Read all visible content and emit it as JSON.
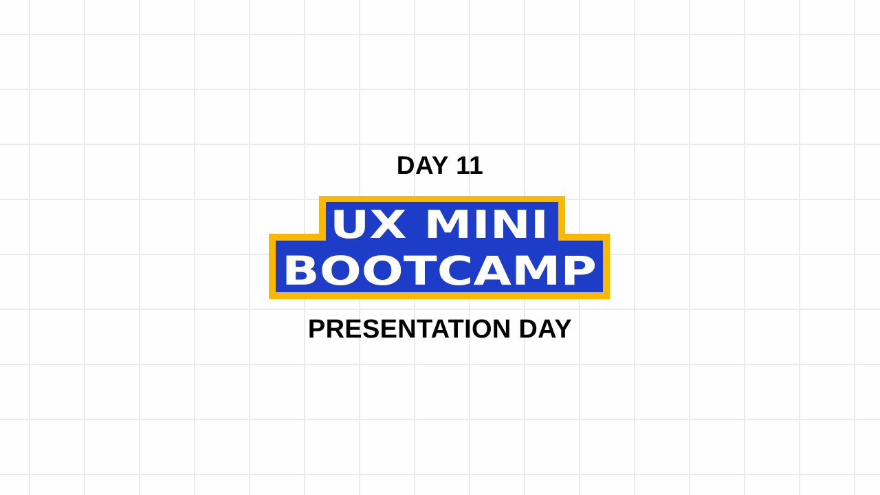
{
  "slide": {
    "day_label": "DAY 11",
    "logo": {
      "line1": "UX MINI",
      "line2": "BOOTCAMP",
      "fill_color": "#1d3dc8",
      "border_color": "#fbb800",
      "text_color": "#ffffff"
    },
    "subtitle": "PRESENTATION DAY"
  },
  "background": {
    "color": "#fefefe",
    "grid_color": "#eaeaea"
  }
}
